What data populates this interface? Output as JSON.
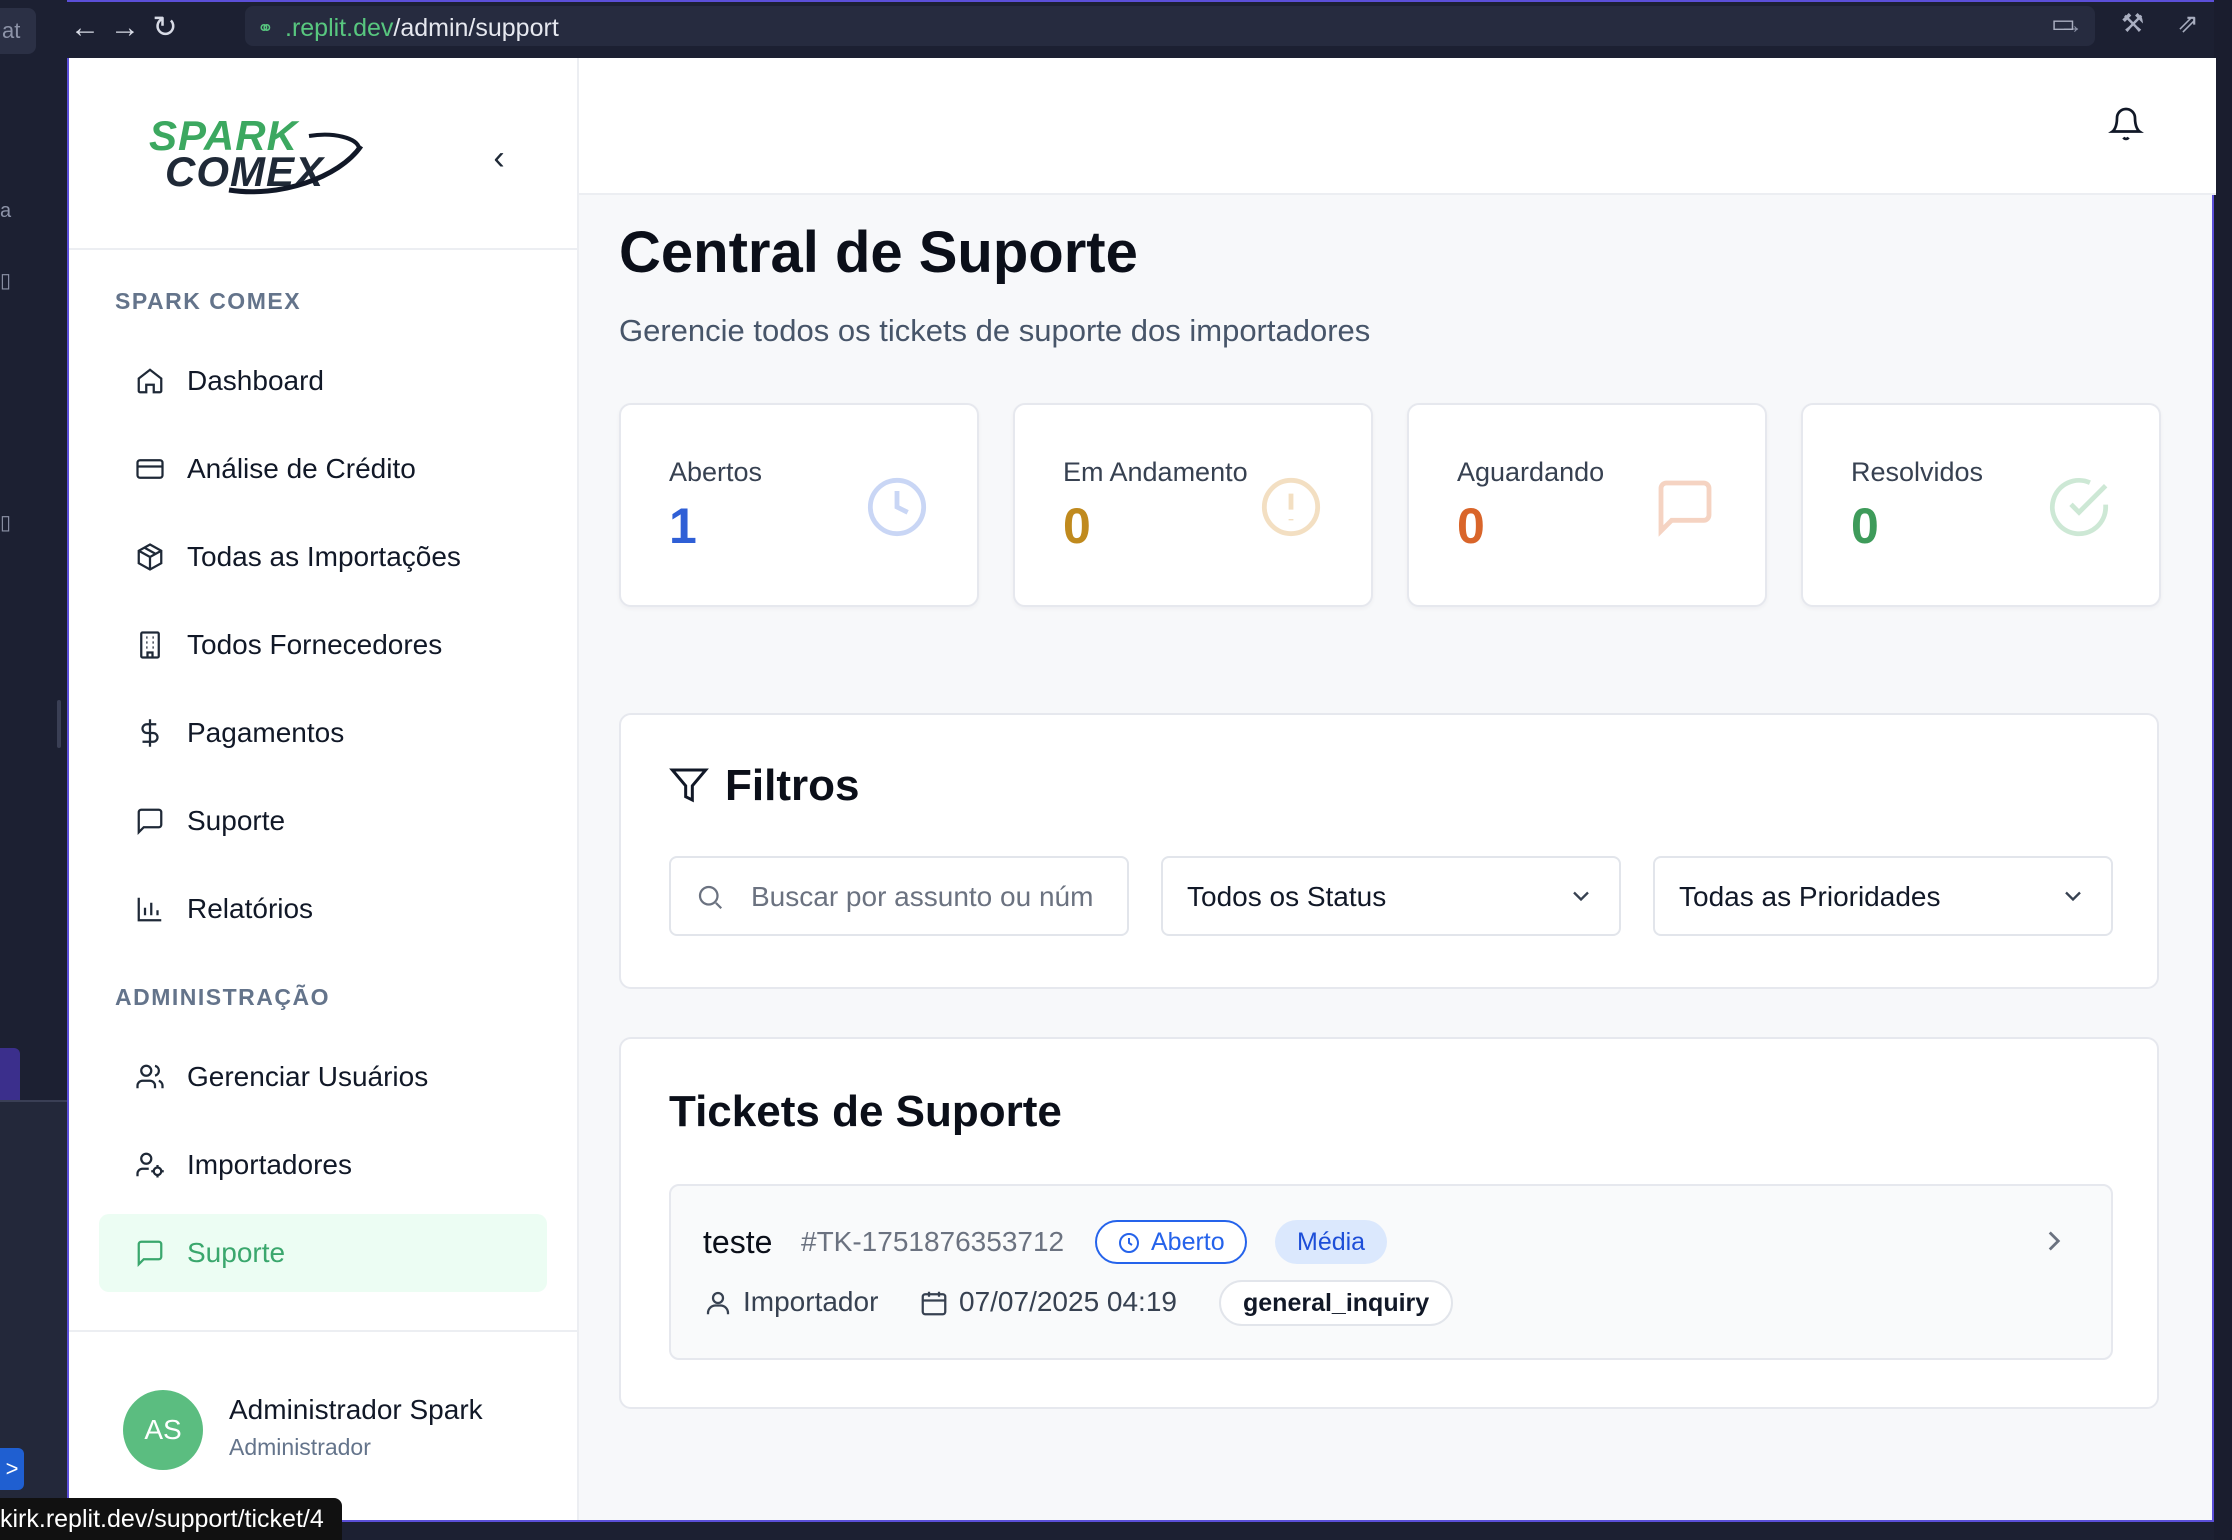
{
  "browser": {
    "url_host": ".replit.dev",
    "url_path": "/admin/support",
    "status_link": "kirk.replit.dev/support/ticket/4"
  },
  "ide": {
    "tab_fragment": "at",
    "glyph_a": "a"
  },
  "sidebar": {
    "logo_line1": "SPARK",
    "logo_line2": "COMEX",
    "section_main": "SPARK COMEX",
    "items": [
      {
        "label": "Dashboard",
        "icon": "home-icon"
      },
      {
        "label": "Análise de Crédito",
        "icon": "credit-card-icon"
      },
      {
        "label": "Todas as Importações",
        "icon": "package-icon"
      },
      {
        "label": "Todos Fornecedores",
        "icon": "building-icon"
      },
      {
        "label": "Pagamentos",
        "icon": "dollar-icon"
      },
      {
        "label": "Suporte",
        "icon": "message-square-icon"
      },
      {
        "label": "Relatórios",
        "icon": "bar-chart-icon"
      }
    ],
    "section_admin": "ADMINISTRAÇÃO",
    "admin_items": [
      {
        "label": "Gerenciar Usuários",
        "icon": "users-icon"
      },
      {
        "label": "Importadores",
        "icon": "user-cog-icon"
      },
      {
        "label": "Suporte",
        "icon": "message-square-icon",
        "active": true
      }
    ],
    "user": {
      "initials": "AS",
      "name": "Administrador Spark",
      "role": "Administrador"
    }
  },
  "page": {
    "title": "Central de Suporte",
    "subtitle": "Gerencie todos os tickets de suporte dos importadores"
  },
  "stats": [
    {
      "label": "Abertos",
      "value": "1",
      "color": "#2f5fd6",
      "icon": "clock-icon"
    },
    {
      "label": "Em Andamento",
      "value": "0",
      "color": "#c08a1e",
      "icon": "alert-circle-icon"
    },
    {
      "label": "Aguardando",
      "value": "0",
      "color": "#d9652a",
      "icon": "message-square-icon"
    },
    {
      "label": "Resolvidos",
      "value": "0",
      "color": "#3e9b5a",
      "icon": "check-circle-icon"
    }
  ],
  "filters": {
    "title": "Filtros",
    "search_placeholder": "Buscar por assunto ou núm",
    "status_value": "Todos os Status",
    "priority_value": "Todas as Prioridades"
  },
  "tickets": {
    "title": "Tickets de Suporte",
    "rows": [
      {
        "subject": "teste",
        "number": "#TK-1751876353712",
        "status": "Aberto",
        "priority": "Média",
        "requester": "Importador",
        "date": "07/07/2025 04:19",
        "category": "general_inquiry"
      }
    ]
  }
}
